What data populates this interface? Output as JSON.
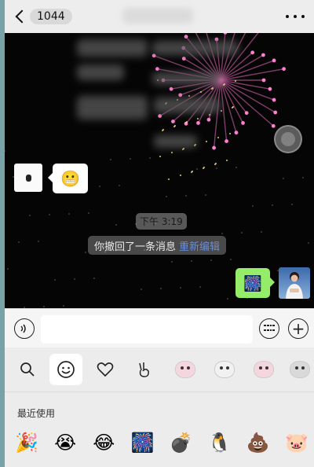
{
  "header": {
    "back_icon": "chevron-left-icon",
    "unread_count": "1044",
    "more_icon": "ellipsis-icon"
  },
  "chat": {
    "background": "#050505",
    "timestamps": [
      "下午 3:19"
    ],
    "recall_notice": {
      "text": "你撤回了一条消息",
      "action": "重新编辑",
      "action_color": "#6a8ed8"
    },
    "messages": [
      {
        "side": "left",
        "content_icon": "grimace-emoji",
        "glyph": "😬"
      },
      {
        "side": "right",
        "content_icon": "fireworks-emoji",
        "glyph": "🎆"
      }
    ]
  },
  "input_bar": {
    "voice_icon": "voice-icon",
    "keyboard_icon": "keyboard-icon",
    "add_icon": "plus-icon",
    "placeholder": ""
  },
  "emoji_panel": {
    "tabs": [
      {
        "name": "search-icon",
        "glyph": "🔍"
      },
      {
        "name": "emoji-icon",
        "glyph": "☺",
        "active": true
      },
      {
        "name": "heart-icon",
        "glyph": "♡"
      },
      {
        "name": "peace-hand-icon",
        "glyph": "✌"
      },
      {
        "name": "cat-sticker-icon"
      },
      {
        "name": "cat-sticker-icon"
      },
      {
        "name": "cat-sticker-icon"
      },
      {
        "name": "bear-sticker-icon"
      }
    ],
    "recent_label": "最近使用",
    "recent": [
      "🎉",
      "😭",
      "😂",
      "🎆",
      "💣",
      "🐧",
      "💩",
      "🐷"
    ],
    "recent_names": [
      "party-popper",
      "crying-face",
      "laughing-face",
      "fireworks",
      "bomb",
      "penguin",
      "poop",
      "pig-face"
    ]
  },
  "colors": {
    "accent_green": "#95ec69",
    "link_blue": "#6a8ed8",
    "firework_pink": "#e86ab8"
  }
}
